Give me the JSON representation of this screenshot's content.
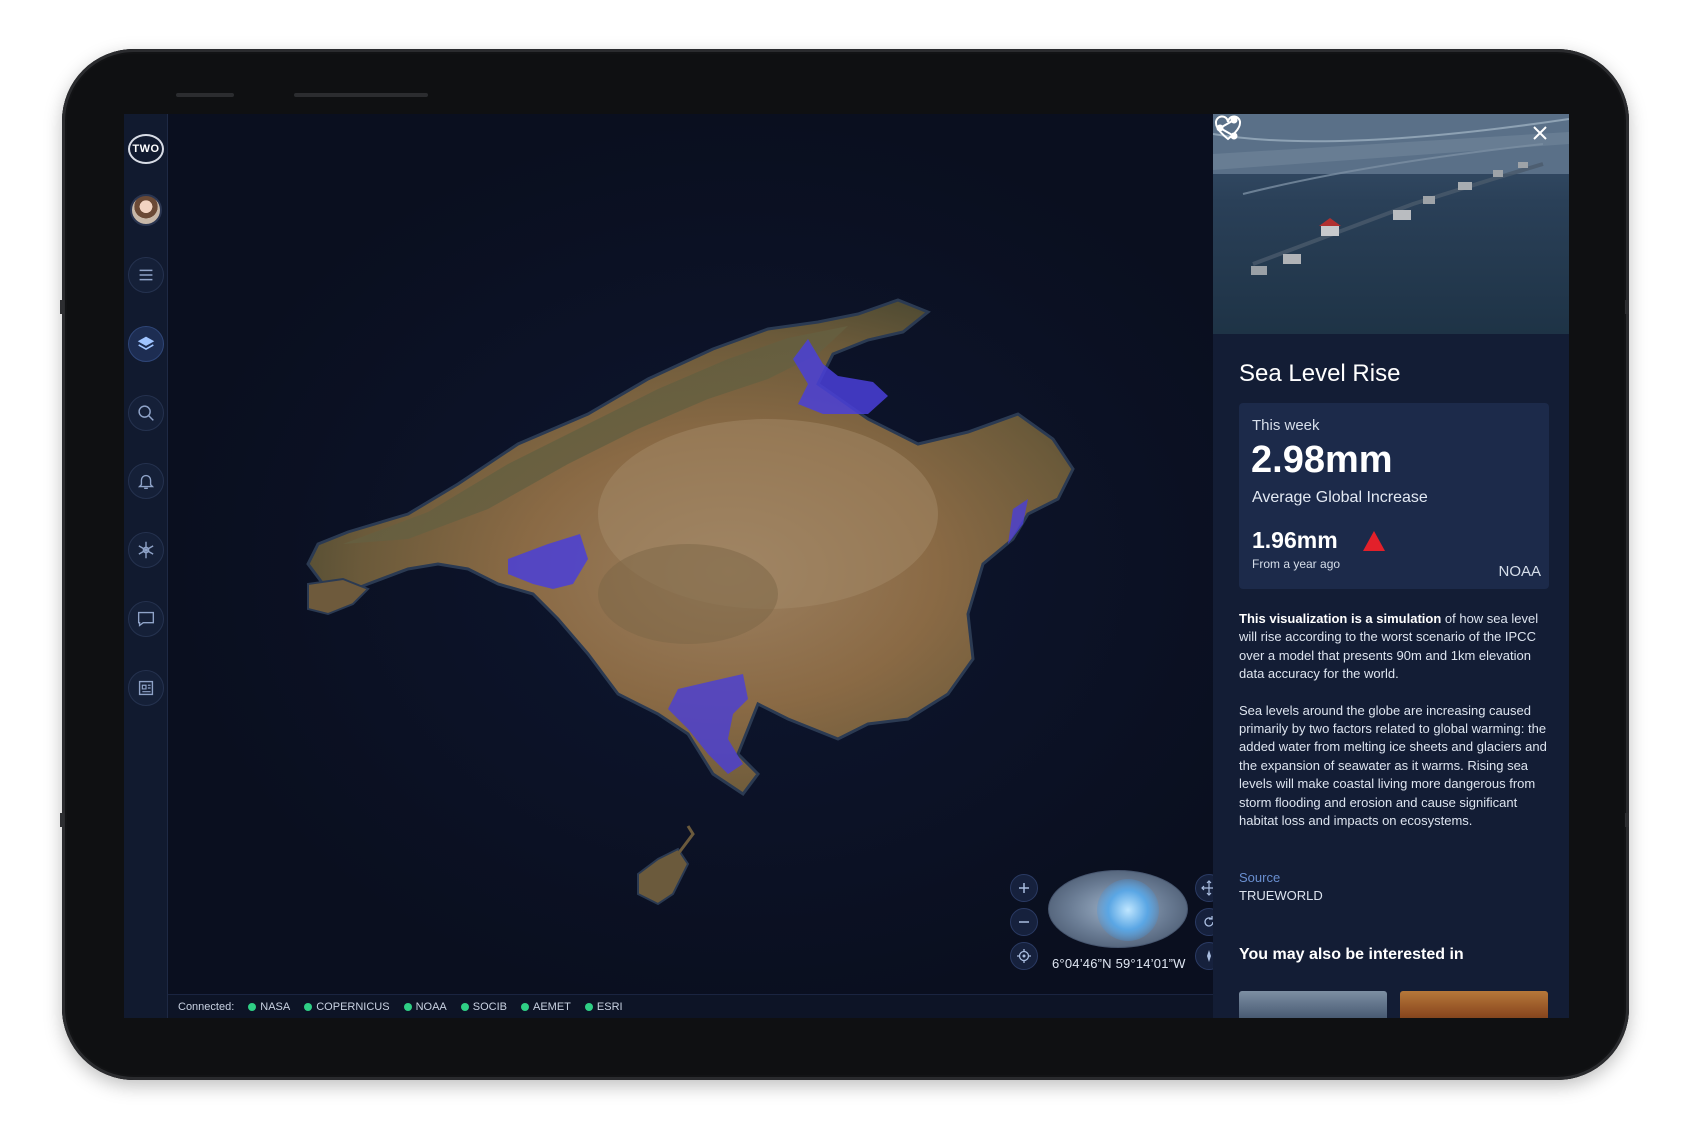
{
  "sidebar": {
    "logo_text": "TWO",
    "items": [
      "menu-icon",
      "layers-icon",
      "search-icon",
      "bell-icon",
      "snowflake-icon",
      "chat-icon",
      "news-icon"
    ]
  },
  "map": {
    "coordinates": "6°04’46”N 59°14’01”W",
    "status": {
      "label": "Connected:",
      "sources": [
        "NASA",
        "COPERNICUS",
        "NOAA",
        "SOCIB",
        "AEMET",
        "ESRI"
      ],
      "status_color": "#2fcf85"
    },
    "controls": [
      "zoom-in",
      "zoom-out",
      "locate",
      "pan",
      "rotate",
      "compass"
    ]
  },
  "panel": {
    "title": "Sea Level Rise",
    "stat": {
      "period": "This week",
      "value": "2.98mm",
      "label": "Average Global Increase",
      "change": "1.96mm",
      "change_note": "From a year ago",
      "trend": "up",
      "source": "NOAA"
    },
    "description_bold": "This visualization is a simulation",
    "description_rest": " of how sea level will rise according to the worst scenario of the IPCC over a model that presents 90m and 1km elevation data accuracy for the world.",
    "description_2": "Sea levels around the globe are increasing caused primarily by two factors related to global warming: the added water from melting ice sheets and glaciers and the expansion of seawater as it warms. Rising sea levels will make coastal living more dangerous from storm flooding and erosion and cause significant habitat loss and impacts on ecosystems.",
    "source_label": "Source",
    "source_value": "TRUEWORLD",
    "interested_title": "You may also be interested in"
  },
  "colors": {
    "accent": "#2fcf85",
    "flood": "#4a3fd8",
    "trend_up": "#e3202a",
    "panel_bg": "#131d35"
  }
}
